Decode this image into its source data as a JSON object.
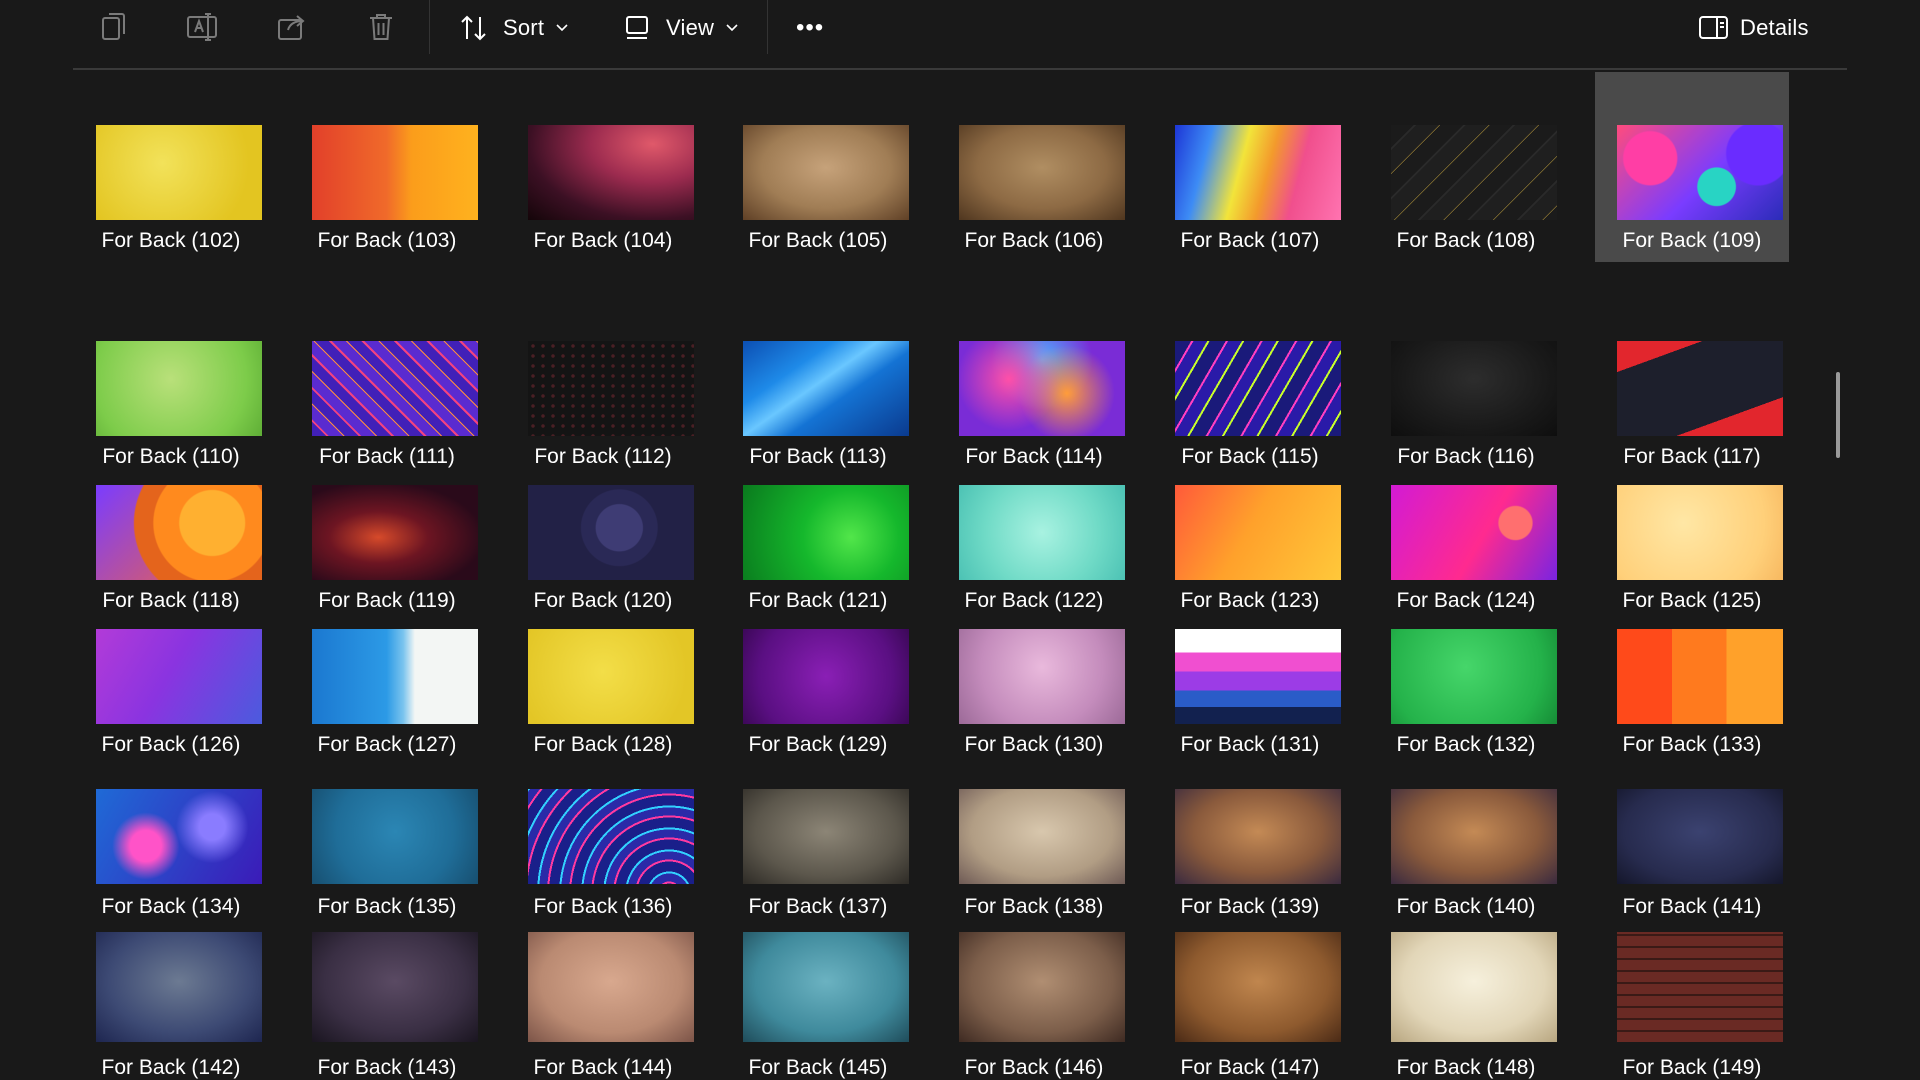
{
  "toolbar": {
    "copy_icon": "copy-icon",
    "rename_icon": "rename-icon",
    "share_icon": "share-icon",
    "delete_icon": "delete-icon",
    "sort_label": "Sort",
    "view_label": "View",
    "more_label": "•••",
    "details_label": "Details"
  },
  "files": [
    {
      "name": "For Back (102)"
    },
    {
      "name": "For Back (103)"
    },
    {
      "name": "For Back (104)"
    },
    {
      "name": "For Back (105)"
    },
    {
      "name": "For Back (106)"
    },
    {
      "name": "For Back (107)"
    },
    {
      "name": "For Back (108)"
    },
    {
      "name": "For Back (109)",
      "selected": true
    },
    {
      "name": "For Back (110)"
    },
    {
      "name": "For Back (111)"
    },
    {
      "name": "For Back (112)"
    },
    {
      "name": "For Back (113)"
    },
    {
      "name": "For Back (114)"
    },
    {
      "name": "For Back (115)"
    },
    {
      "name": "For Back (116)"
    },
    {
      "name": "For Back (117)"
    },
    {
      "name": "For Back (118)"
    },
    {
      "name": "For Back (119)"
    },
    {
      "name": "For Back (120)"
    },
    {
      "name": "For Back (121)"
    },
    {
      "name": "For Back (122)"
    },
    {
      "name": "For Back (123)"
    },
    {
      "name": "For Back (124)"
    },
    {
      "name": "For Back (125)"
    },
    {
      "name": "For Back (126)"
    },
    {
      "name": "For Back (127)"
    },
    {
      "name": "For Back (128)"
    },
    {
      "name": "For Back (129)"
    },
    {
      "name": "For Back (130)"
    },
    {
      "name": "For Back (131)"
    },
    {
      "name": "For Back (132)"
    },
    {
      "name": "For Back (133)"
    },
    {
      "name": "For Back (134)"
    },
    {
      "name": "For Back (135)"
    },
    {
      "name": "For Back (136)"
    },
    {
      "name": "For Back (137)"
    },
    {
      "name": "For Back (138)"
    },
    {
      "name": "For Back (139)"
    },
    {
      "name": "For Back (140)"
    },
    {
      "name": "For Back (141)"
    },
    {
      "name": "For Back (142)"
    },
    {
      "name": "For Back (143)"
    },
    {
      "name": "For Back (144)"
    },
    {
      "name": "For Back (145)"
    },
    {
      "name": "For Back (146)"
    },
    {
      "name": "For Back (147)"
    },
    {
      "name": "For Back (148)"
    },
    {
      "name": "For Back (149)"
    }
  ],
  "colors": {
    "background": "#191919",
    "selected_tile": "#4a4a4a",
    "text": "#ffffff",
    "disabled_icon": "#6a6a6a"
  }
}
